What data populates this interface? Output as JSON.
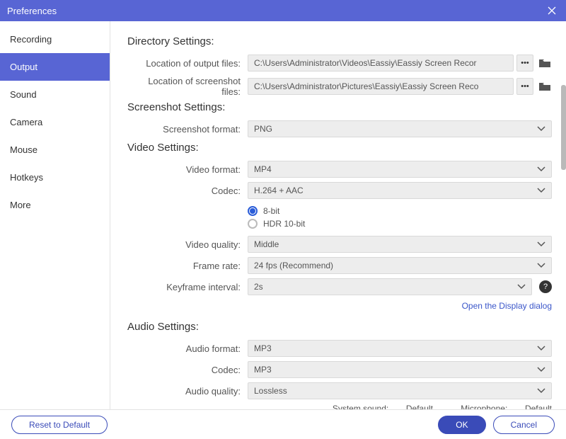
{
  "window": {
    "title": "Preferences"
  },
  "sidebar": {
    "items": [
      {
        "label": "Recording"
      },
      {
        "label": "Output"
      },
      {
        "label": "Sound"
      },
      {
        "label": "Camera"
      },
      {
        "label": "Mouse"
      },
      {
        "label": "Hotkeys"
      },
      {
        "label": "More"
      }
    ],
    "active_index": 1
  },
  "sections": {
    "directory": {
      "title": "Directory Settings:",
      "output_label": "Location of output files:",
      "output_path": "C:\\Users\\Administrator\\Videos\\Eassiy\\Eassiy Screen Recor",
      "screenshot_label": "Location of screenshot files:",
      "screenshot_path": "C:\\Users\\Administrator\\Pictures\\Eassiy\\Eassiy Screen Reco"
    },
    "screenshot": {
      "title": "Screenshot Settings:",
      "format_label": "Screenshot format:",
      "format_value": "PNG"
    },
    "video": {
      "title": "Video Settings:",
      "format_label": "Video format:",
      "format_value": "MP4",
      "codec_label": "Codec:",
      "codec_value": "H.264 + AAC",
      "bit8_label": "8-bit",
      "hdr_label": "HDR 10-bit",
      "quality_label": "Video quality:",
      "quality_value": "Middle",
      "framerate_label": "Frame rate:",
      "framerate_value": "24 fps (Recommend)",
      "keyframe_label": "Keyframe interval:",
      "keyframe_value": "2s",
      "display_link": "Open the Display dialog"
    },
    "audio": {
      "title": "Audio Settings:",
      "format_label": "Audio format:",
      "format_value": "MP3",
      "codec_label": "Codec:",
      "codec_value": "MP3",
      "quality_label": "Audio quality:",
      "quality_value": "Lossless"
    },
    "status": {
      "system_sound_label": "System sound:",
      "system_sound_value": "Default",
      "microphone_label": "Microphone:",
      "microphone_value": "Default"
    }
  },
  "footer": {
    "reset_label": "Reset to Default",
    "ok_label": "OK",
    "cancel_label": "Cancel"
  }
}
